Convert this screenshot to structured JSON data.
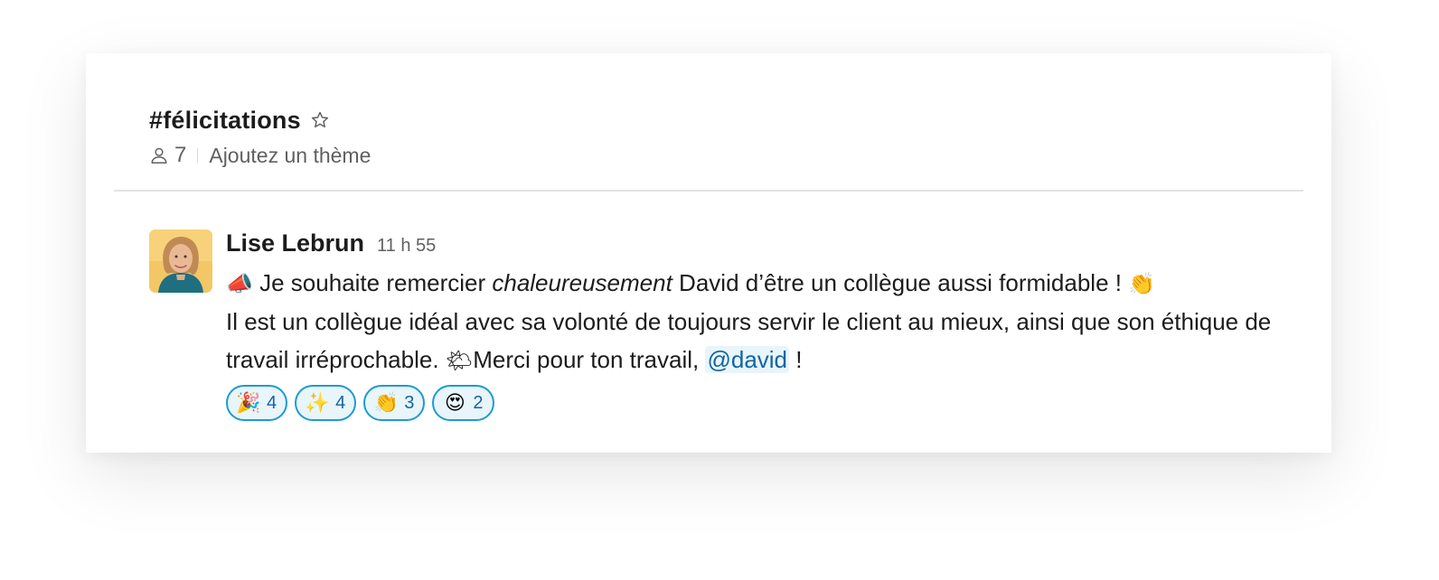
{
  "channel": {
    "name": "#félicitations",
    "member_count": "7",
    "topic_placeholder": "Ajoutez un thème"
  },
  "message": {
    "author": "Lise Lebrun",
    "timestamp": "11 h 55",
    "line1_emoji": "📣",
    "line1_pre": "Je souhaite remercier ",
    "line1_em": "chaleureusement",
    "line1_post": " David d’être un collègue aussi formidable !",
    "line1_end_emoji": "👏",
    "line2": "Il est un collègue idéal avec sa volonté de toujours servir le client au mieux, ainsi que son éthique de travail irréprochable. ",
    "line2_emoji": "🌤",
    "line2_post": "Merci pour ton travail, ",
    "mention": "@david",
    "line2_end": " !"
  },
  "reactions": [
    {
      "emoji": "🎉",
      "count": "4"
    },
    {
      "emoji": "✨",
      "count": "4"
    },
    {
      "emoji": "👏",
      "count": "3"
    },
    {
      "emoji": "😍",
      "count": "2"
    }
  ],
  "colors": {
    "accent": "#1264a3",
    "reaction_border": "#1d9bd1",
    "reaction_bg": "#e8f5fa"
  },
  "icons": {
    "star": "star-icon",
    "members": "user-icon"
  }
}
